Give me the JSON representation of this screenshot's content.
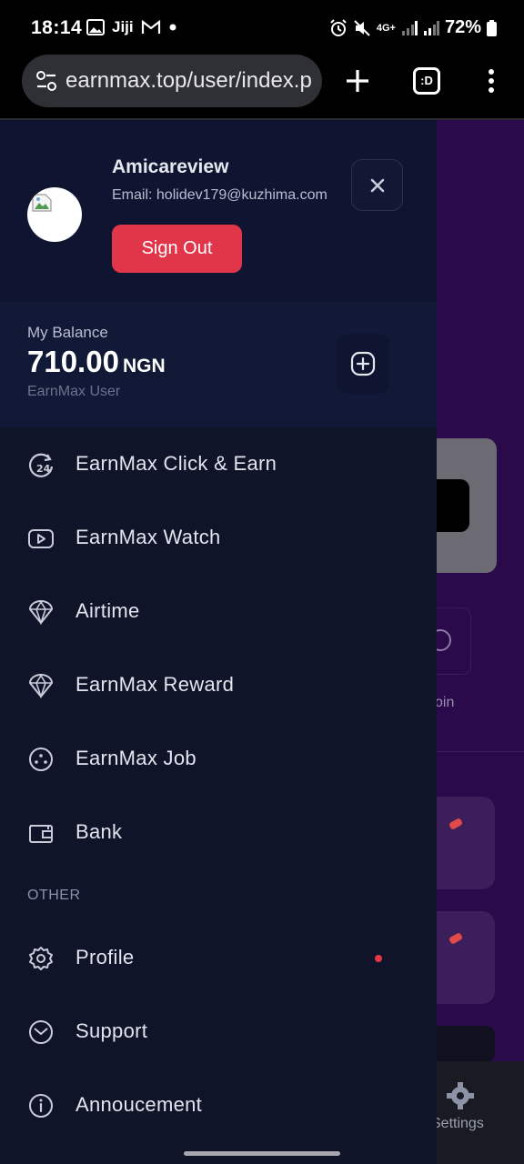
{
  "status_bar": {
    "time": "18:14",
    "left_icons": [
      "image-icon",
      "jiji-icon",
      "gmail-icon",
      "dot-icon"
    ],
    "jiji_text": "Jiji",
    "network": "4G+",
    "battery": "72%"
  },
  "browser": {
    "url": "earnmax.top/user/index.p",
    "tabs_label": ":D"
  },
  "drawer": {
    "user_name": "Amicareview",
    "email_label": "Email:",
    "email": "holidev179@kuzhima.com",
    "sign_out_label": "Sign Out",
    "balance_label": "My Balance",
    "balance_amount": "710.00",
    "balance_currency": "NGN",
    "balance_sub": "EarnMax User",
    "menu": [
      {
        "label": "EarnMax Click & Earn",
        "icon": "clock-24-icon"
      },
      {
        "label": "EarnMax Watch",
        "icon": "youtube-icon"
      },
      {
        "label": "Airtime",
        "icon": "diamond-icon"
      },
      {
        "label": "EarnMax Reward",
        "icon": "diamond-icon"
      },
      {
        "label": "EarnMax Job",
        "icon": "dice-icon"
      },
      {
        "label": "Bank",
        "icon": "wallet-icon"
      }
    ],
    "other_label": "OTHER",
    "other_menu": [
      {
        "label": "Profile",
        "icon": "gear-icon"
      },
      {
        "label": "Support",
        "icon": "mail-icon"
      },
      {
        "label": "Annoucement",
        "icon": "info-icon"
      }
    ]
  },
  "background_page": {
    "coin_text": "oin",
    "settings_label": "Settings"
  },
  "colors": {
    "drawer_bg": "#0f1429",
    "accent_red": "#e1364a",
    "page_bg": "#2a0a4a"
  }
}
